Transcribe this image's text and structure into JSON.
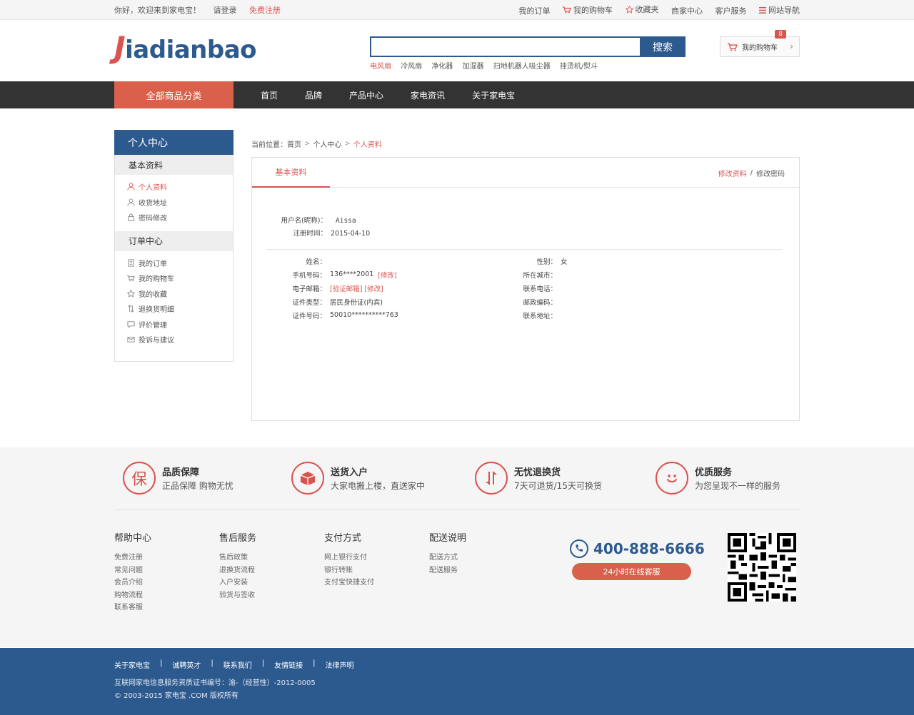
{
  "topbar": {
    "welcome": "你好，欢迎来到家电宝！",
    "login": "请登录",
    "register": "免费注册",
    "links": [
      "我的订单",
      "我的购物车",
      "收藏夹",
      "商家中心",
      "客户服务",
      "网站导航"
    ]
  },
  "header": {
    "logo_first": "J",
    "logo_rest": "iadianbao",
    "search_button": "搜索",
    "hotwords": [
      "电风扇",
      "冷风扇",
      "净化器",
      "加湿器",
      "扫地机器人吸尘器",
      "挂烫机/熨斗"
    ],
    "cart_label": "我的购物车",
    "cart_count": "8"
  },
  "nav": {
    "all": "全部商品分类",
    "items": [
      "首页",
      "品牌",
      "产品中心",
      "家电资讯",
      "关于家电宝"
    ]
  },
  "sidebar": {
    "title": "个人中心",
    "group1": "基本资料",
    "group1_items": [
      "个人资料",
      "收货地址",
      "密码修改"
    ],
    "group2": "订单中心",
    "group2_items": [
      "我的订单",
      "我的购物车",
      "我的收藏",
      "退换货明细",
      "评价管理",
      "投诉与建议"
    ]
  },
  "crumb": {
    "prefix": "当前位置：",
    "items": [
      "首页",
      "个人中心",
      "个人资料"
    ]
  },
  "panel": {
    "tab": "基本资料",
    "edit_profile": "修改资料",
    "edit_password": "修改密码",
    "sep": "/"
  },
  "user": {
    "nickname_label": "用户名(昵称)：",
    "nickname": "Aissa",
    "regtime_label": "注册时间：",
    "regtime": "2015-04-10"
  },
  "fields_left": [
    {
      "k": "姓名：",
      "v": "",
      "extra": ""
    },
    {
      "k": "手机号码：",
      "v": "136****2001",
      "extra": "[修改]"
    },
    {
      "k": "电子邮箱：",
      "v": "",
      "extra": "[验证邮箱]  [修改]"
    },
    {
      "k": "证件类型：",
      "v": "居民身份证(内宾)",
      "extra": ""
    },
    {
      "k": "证件号码：",
      "v": "50010**********763",
      "extra": ""
    }
  ],
  "fields_right": [
    {
      "k": "性别：",
      "v": "女"
    },
    {
      "k": "所在城市：",
      "v": ""
    },
    {
      "k": "联系电话：",
      "v": ""
    },
    {
      "k": "邮政编码：",
      "v": ""
    },
    {
      "k": "联系地址：",
      "v": ""
    }
  ],
  "services": [
    {
      "icon": "保",
      "t1": "品质保障",
      "t2": "正品保障 购物无忧"
    },
    {
      "icon": "box",
      "t1": "送货入户",
      "t2": "大家电搬上楼，直送家中"
    },
    {
      "icon": "arrows",
      "t1": "无忧退换货",
      "t2": "7天可退货/15天可换货"
    },
    {
      "icon": "smile",
      "t1": "优质服务",
      "t2": "为您呈现不一样的服务"
    }
  ],
  "help": [
    {
      "h": "帮助中心",
      "items": [
        "免费注册",
        "常见问题",
        "会员介绍",
        "购物流程",
        "联系客服"
      ]
    },
    {
      "h": "售后服务",
      "items": [
        "售后政策",
        "退换货流程",
        "入户安装",
        "验货与签收"
      ]
    },
    {
      "h": "支付方式",
      "items": [
        "网上银行支付",
        "银行转账",
        "支付宝快捷支付"
      ]
    },
    {
      "h": "配送说明",
      "items": [
        "配送方式",
        "配送服务"
      ]
    }
  ],
  "contact": {
    "phone": "400-888-6666",
    "online": "24小时在线客服"
  },
  "bottom": {
    "links": [
      "关于家电宝",
      "诚聘英才",
      "联系我们",
      "友情链接",
      "法律声明"
    ],
    "license": "互联网家电信息服务资质证书编号：渝-（经营性）-2012-0005",
    "copyright": "© 2003-2015 家电宝 .COM 版权所有"
  },
  "colors": {
    "brand": "#2d5a8e",
    "accent": "#d9534f"
  }
}
